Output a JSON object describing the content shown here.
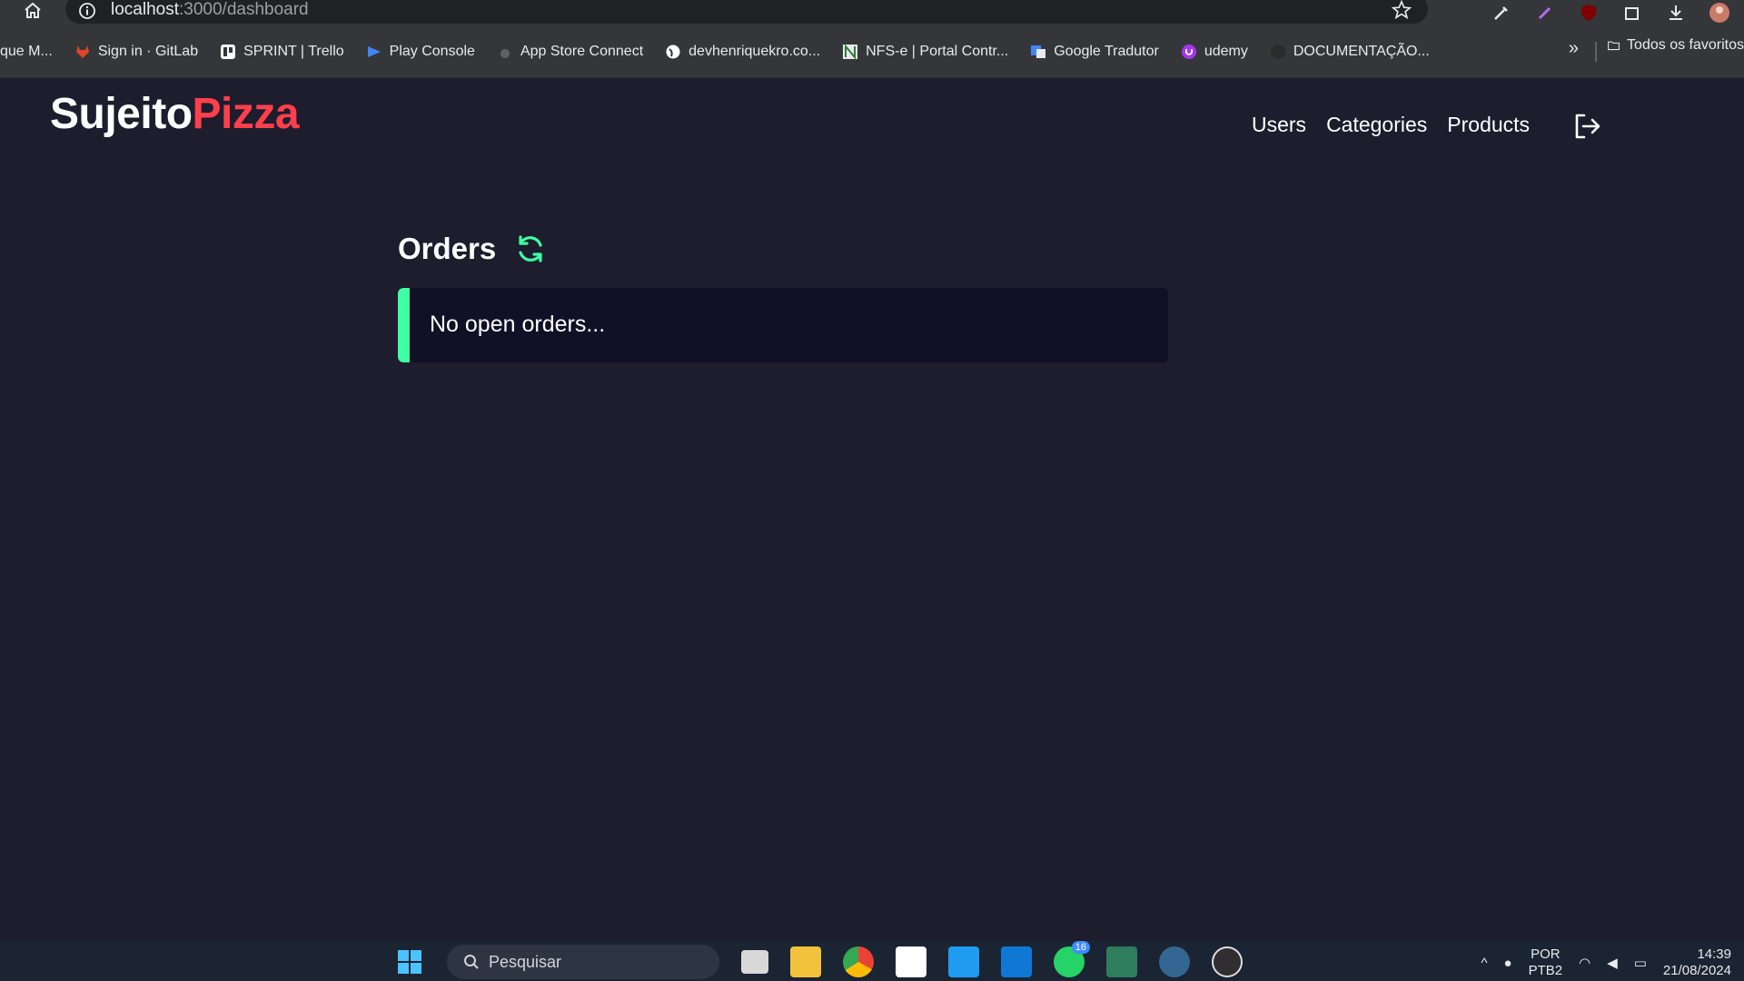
{
  "browser": {
    "url_host": "localhost",
    "url_path": ":3000/dashboard",
    "bookmarks": [
      {
        "label": "que M...",
        "icon": "bookmark-icon",
        "color": "#9aa0a6"
      },
      {
        "label": "Sign in · GitLab",
        "icon": "gitlab-icon",
        "color": "#e24329"
      },
      {
        "label": "SPRINT | Trello",
        "icon": "trello-icon",
        "color": "#ffffff"
      },
      {
        "label": "Play Console",
        "icon": "play-console-icon",
        "color": "#4285f4"
      },
      {
        "label": "App Store Connect",
        "icon": "apple-icon",
        "color": "#9aa0a6"
      },
      {
        "label": "devhenriquekro.co...",
        "icon": "globe-icon",
        "color": "#ffffff"
      },
      {
        "label": "NFS-e | Portal Contr...",
        "icon": "nfse-icon",
        "color": "#2e7d32"
      },
      {
        "label": "Google Tradutor",
        "icon": "google-translate-icon",
        "color": "#4285f4"
      },
      {
        "label": "udemy",
        "icon": "udemy-icon",
        "color": "#a435f0"
      },
      {
        "label": "DOCUMENTAÇÃO...",
        "icon": "github-icon",
        "color": "#2b2b2b"
      }
    ],
    "more_label": "»",
    "folder_label": "Todos os favoritos"
  },
  "app": {
    "logo_part1": "Sujeito",
    "logo_part2": "Pizza",
    "nav": [
      "Users",
      "Categories",
      "Products"
    ],
    "orders_title": "Orders",
    "empty_message": "No open orders...",
    "accent_color": "#3fffa3",
    "brand_color": "#ff3f4b"
  },
  "taskbar": {
    "search_placeholder": "Pesquisar",
    "lang_top": "POR",
    "lang_bottom": "PTB2",
    "time": "14:39",
    "date": "21/08/2024",
    "whatsapp_badge": "16"
  }
}
